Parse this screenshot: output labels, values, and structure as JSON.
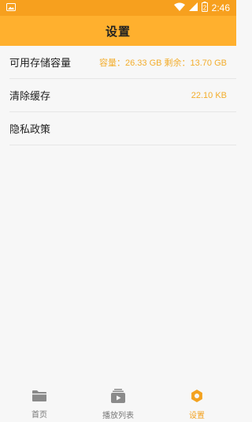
{
  "status_bar": {
    "time": "2:46",
    "battery_level": "2"
  },
  "app_bar": {
    "title": "设置"
  },
  "settings": [
    {
      "label": "可用存储容量",
      "value": "容量：26.33 GB  剩余：13.70 GB"
    },
    {
      "label": "清除缓存",
      "value": "22.10 KB"
    },
    {
      "label": "隐私政策",
      "value": ""
    }
  ],
  "tabs": [
    {
      "label": "首页",
      "icon": "folder-icon",
      "active": false
    },
    {
      "label": "播放列表",
      "icon": "playlist-icon",
      "active": false
    },
    {
      "label": "设置",
      "icon": "settings-icon",
      "active": true
    }
  ],
  "colors": {
    "accent": "#ffb02e",
    "status_bar": "#f7a01e",
    "value_text": "#f3ad2c",
    "inactive_icon": "#8a8a8a"
  }
}
